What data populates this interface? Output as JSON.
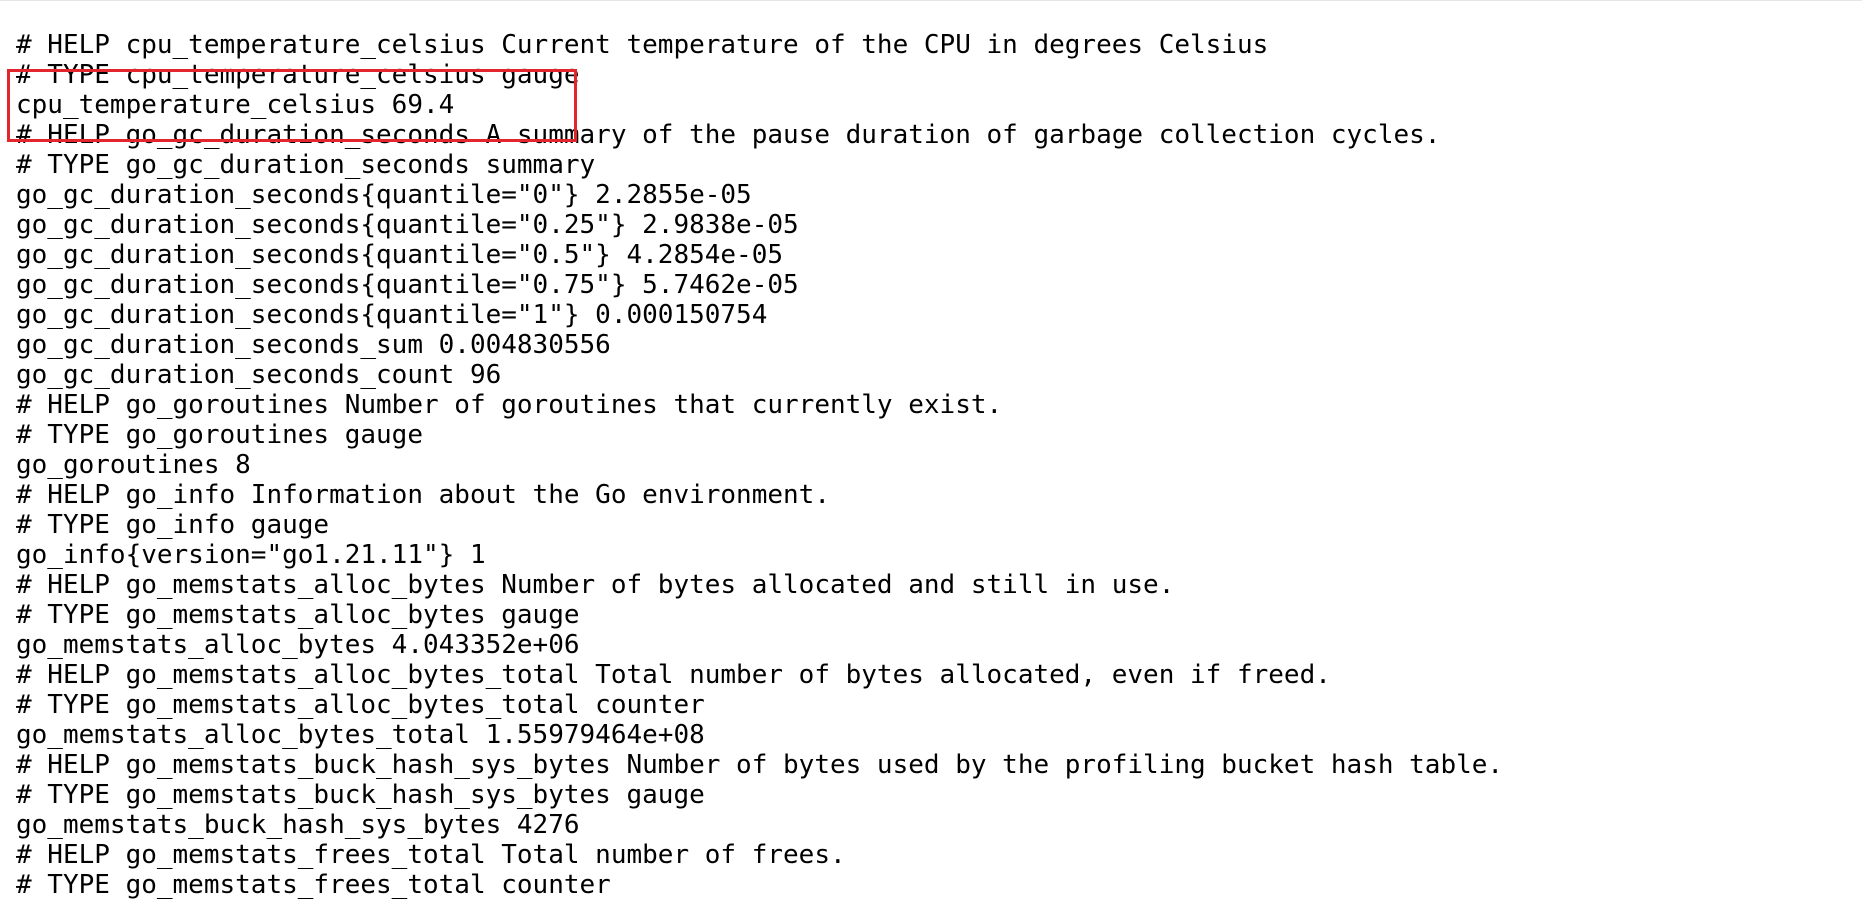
{
  "highlight_color": "#e3262d",
  "lines": [
    "# HELP cpu_temperature_celsius Current temperature of the CPU in degrees Celsius",
    "# TYPE cpu_temperature_celsius gauge",
    "cpu_temperature_celsius 69.4",
    "# HELP go_gc_duration_seconds A summary of the pause duration of garbage collection cycles.",
    "# TYPE go_gc_duration_seconds summary",
    "go_gc_duration_seconds{quantile=\"0\"} 2.2855e-05",
    "go_gc_duration_seconds{quantile=\"0.25\"} 2.9838e-05",
    "go_gc_duration_seconds{quantile=\"0.5\"} 4.2854e-05",
    "go_gc_duration_seconds{quantile=\"0.75\"} 5.7462e-05",
    "go_gc_duration_seconds{quantile=\"1\"} 0.000150754",
    "go_gc_duration_seconds_sum 0.004830556",
    "go_gc_duration_seconds_count 96",
    "# HELP go_goroutines Number of goroutines that currently exist.",
    "# TYPE go_goroutines gauge",
    "go_goroutines 8",
    "# HELP go_info Information about the Go environment.",
    "# TYPE go_info gauge",
    "go_info{version=\"go1.21.11\"} 1",
    "# HELP go_memstats_alloc_bytes Number of bytes allocated and still in use.",
    "# TYPE go_memstats_alloc_bytes gauge",
    "go_memstats_alloc_bytes 4.043352e+06",
    "# HELP go_memstats_alloc_bytes_total Total number of bytes allocated, even if freed.",
    "# TYPE go_memstats_alloc_bytes_total counter",
    "go_memstats_alloc_bytes_total 1.55979464e+08",
    "# HELP go_memstats_buck_hash_sys_bytes Number of bytes used by the profiling bucket hash table.",
    "# TYPE go_memstats_buck_hash_sys_bytes gauge",
    "go_memstats_buck_hash_sys_bytes 4276",
    "# HELP go_memstats_frees_total Total number of frees.",
    "# TYPE go_memstats_frees_total counter"
  ]
}
